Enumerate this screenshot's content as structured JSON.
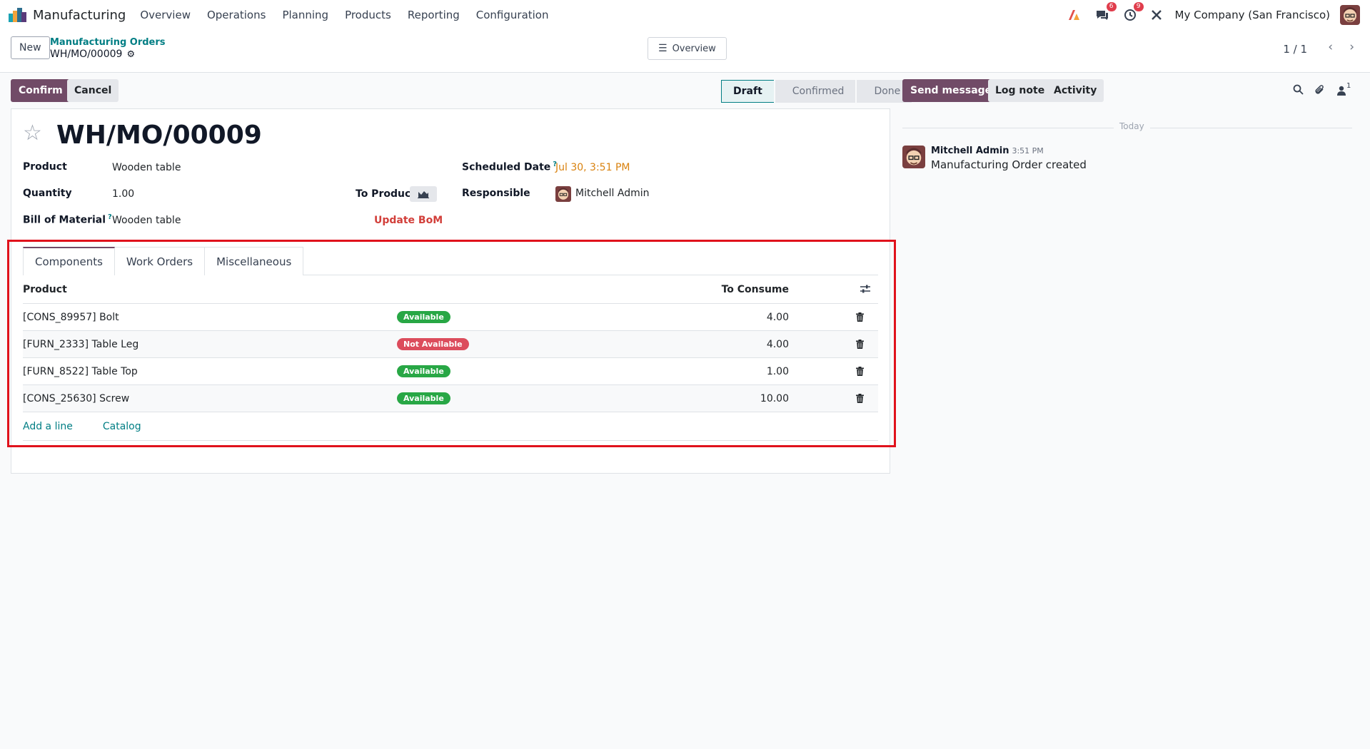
{
  "navbar": {
    "app_name": "Manufacturing",
    "menu": [
      "Overview",
      "Operations",
      "Planning",
      "Products",
      "Reporting",
      "Configuration"
    ],
    "messages_count": "6",
    "activities_count": "9",
    "company": "My Company (San Francisco)"
  },
  "control_panel": {
    "new_label": "New",
    "breadcrumb_parent": "Manufacturing Orders",
    "breadcrumb_current": "WH/MO/00009",
    "overview_label": "Overview",
    "pager": "1 / 1"
  },
  "actions": {
    "confirm": "Confirm",
    "cancel": "Cancel"
  },
  "stages": [
    "Draft",
    "Confirmed",
    "Done"
  ],
  "active_stage": "Draft",
  "form": {
    "title": "WH/MO/00009",
    "product_label": "Product",
    "product_value": "Wooden table",
    "quantity_label": "Quantity",
    "quantity_value": "1.00",
    "to_produce_label": "To Produce",
    "bom_label": "Bill of Material",
    "bom_help": "?",
    "bom_value": "Wooden table",
    "update_bom": "Update BoM",
    "scheduled_label": "Scheduled Date",
    "scheduled_help": "?",
    "scheduled_value": "Jul 30, 3:51 PM",
    "responsible_label": "Responsible",
    "responsible_value": "Mitchell Admin"
  },
  "tabs": [
    "Components",
    "Work Orders",
    "Miscellaneous"
  ],
  "components_table": {
    "col_product": "Product",
    "col_consume": "To Consume",
    "rows": [
      {
        "product": "[CONS_89957] Bolt",
        "status": "Available",
        "qty": "4.00"
      },
      {
        "product": "[FURN_2333] Table Leg",
        "status": "Not Available",
        "qty": "4.00"
      },
      {
        "product": "[FURN_8522] Table Top",
        "status": "Available",
        "qty": "1.00"
      },
      {
        "product": "[CONS_25630] Screw",
        "status": "Available",
        "qty": "10.00"
      }
    ],
    "add_line": "Add a line",
    "catalog": "Catalog"
  },
  "chatter": {
    "send_message": "Send message",
    "log_note": "Log note",
    "activity": "Activity",
    "followers_count": "1",
    "date_separator": "Today",
    "author": "Mitchell Admin",
    "time": "3:51 PM",
    "body": "Manufacturing Order created"
  },
  "colors": {
    "brand": "#714b67",
    "link": "#017e84",
    "available": "#28a745",
    "not_available": "#dc4c5c",
    "highlight_box": "#e0121c"
  }
}
